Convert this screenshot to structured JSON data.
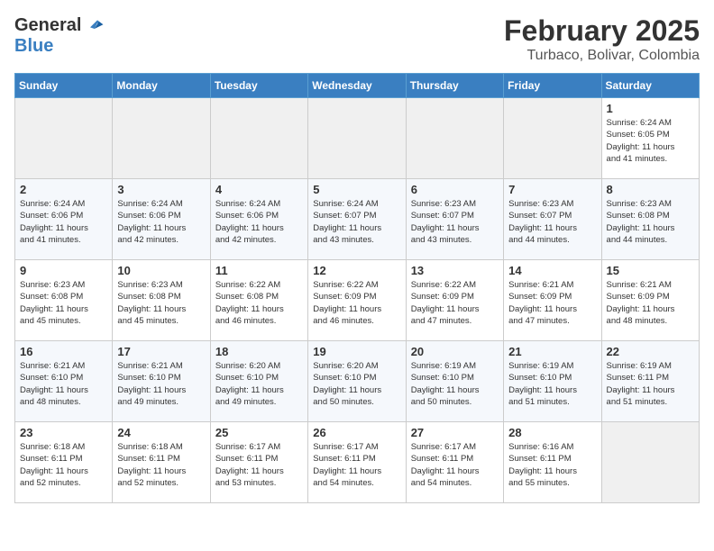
{
  "header": {
    "logo_general": "General",
    "logo_blue": "Blue",
    "month_year": "February 2025",
    "location": "Turbaco, Bolivar, Colombia"
  },
  "days_of_week": [
    "Sunday",
    "Monday",
    "Tuesday",
    "Wednesday",
    "Thursday",
    "Friday",
    "Saturday"
  ],
  "weeks": [
    [
      {
        "day": "",
        "info": ""
      },
      {
        "day": "",
        "info": ""
      },
      {
        "day": "",
        "info": ""
      },
      {
        "day": "",
        "info": ""
      },
      {
        "day": "",
        "info": ""
      },
      {
        "day": "",
        "info": ""
      },
      {
        "day": "1",
        "info": "Sunrise: 6:24 AM\nSunset: 6:05 PM\nDaylight: 11 hours\nand 41 minutes."
      }
    ],
    [
      {
        "day": "2",
        "info": "Sunrise: 6:24 AM\nSunset: 6:06 PM\nDaylight: 11 hours\nand 41 minutes."
      },
      {
        "day": "3",
        "info": "Sunrise: 6:24 AM\nSunset: 6:06 PM\nDaylight: 11 hours\nand 42 minutes."
      },
      {
        "day": "4",
        "info": "Sunrise: 6:24 AM\nSunset: 6:06 PM\nDaylight: 11 hours\nand 42 minutes."
      },
      {
        "day": "5",
        "info": "Sunrise: 6:24 AM\nSunset: 6:07 PM\nDaylight: 11 hours\nand 43 minutes."
      },
      {
        "day": "6",
        "info": "Sunrise: 6:23 AM\nSunset: 6:07 PM\nDaylight: 11 hours\nand 43 minutes."
      },
      {
        "day": "7",
        "info": "Sunrise: 6:23 AM\nSunset: 6:07 PM\nDaylight: 11 hours\nand 44 minutes."
      },
      {
        "day": "8",
        "info": "Sunrise: 6:23 AM\nSunset: 6:08 PM\nDaylight: 11 hours\nand 44 minutes."
      }
    ],
    [
      {
        "day": "9",
        "info": "Sunrise: 6:23 AM\nSunset: 6:08 PM\nDaylight: 11 hours\nand 45 minutes."
      },
      {
        "day": "10",
        "info": "Sunrise: 6:23 AM\nSunset: 6:08 PM\nDaylight: 11 hours\nand 45 minutes."
      },
      {
        "day": "11",
        "info": "Sunrise: 6:22 AM\nSunset: 6:08 PM\nDaylight: 11 hours\nand 46 minutes."
      },
      {
        "day": "12",
        "info": "Sunrise: 6:22 AM\nSunset: 6:09 PM\nDaylight: 11 hours\nand 46 minutes."
      },
      {
        "day": "13",
        "info": "Sunrise: 6:22 AM\nSunset: 6:09 PM\nDaylight: 11 hours\nand 47 minutes."
      },
      {
        "day": "14",
        "info": "Sunrise: 6:21 AM\nSunset: 6:09 PM\nDaylight: 11 hours\nand 47 minutes."
      },
      {
        "day": "15",
        "info": "Sunrise: 6:21 AM\nSunset: 6:09 PM\nDaylight: 11 hours\nand 48 minutes."
      }
    ],
    [
      {
        "day": "16",
        "info": "Sunrise: 6:21 AM\nSunset: 6:10 PM\nDaylight: 11 hours\nand 48 minutes."
      },
      {
        "day": "17",
        "info": "Sunrise: 6:21 AM\nSunset: 6:10 PM\nDaylight: 11 hours\nand 49 minutes."
      },
      {
        "day": "18",
        "info": "Sunrise: 6:20 AM\nSunset: 6:10 PM\nDaylight: 11 hours\nand 49 minutes."
      },
      {
        "day": "19",
        "info": "Sunrise: 6:20 AM\nSunset: 6:10 PM\nDaylight: 11 hours\nand 50 minutes."
      },
      {
        "day": "20",
        "info": "Sunrise: 6:19 AM\nSunset: 6:10 PM\nDaylight: 11 hours\nand 50 minutes."
      },
      {
        "day": "21",
        "info": "Sunrise: 6:19 AM\nSunset: 6:10 PM\nDaylight: 11 hours\nand 51 minutes."
      },
      {
        "day": "22",
        "info": "Sunrise: 6:19 AM\nSunset: 6:11 PM\nDaylight: 11 hours\nand 51 minutes."
      }
    ],
    [
      {
        "day": "23",
        "info": "Sunrise: 6:18 AM\nSunset: 6:11 PM\nDaylight: 11 hours\nand 52 minutes."
      },
      {
        "day": "24",
        "info": "Sunrise: 6:18 AM\nSunset: 6:11 PM\nDaylight: 11 hours\nand 52 minutes."
      },
      {
        "day": "25",
        "info": "Sunrise: 6:17 AM\nSunset: 6:11 PM\nDaylight: 11 hours\nand 53 minutes."
      },
      {
        "day": "26",
        "info": "Sunrise: 6:17 AM\nSunset: 6:11 PM\nDaylight: 11 hours\nand 54 minutes."
      },
      {
        "day": "27",
        "info": "Sunrise: 6:17 AM\nSunset: 6:11 PM\nDaylight: 11 hours\nand 54 minutes."
      },
      {
        "day": "28",
        "info": "Sunrise: 6:16 AM\nSunset: 6:11 PM\nDaylight: 11 hours\nand 55 minutes."
      },
      {
        "day": "",
        "info": ""
      }
    ]
  ]
}
